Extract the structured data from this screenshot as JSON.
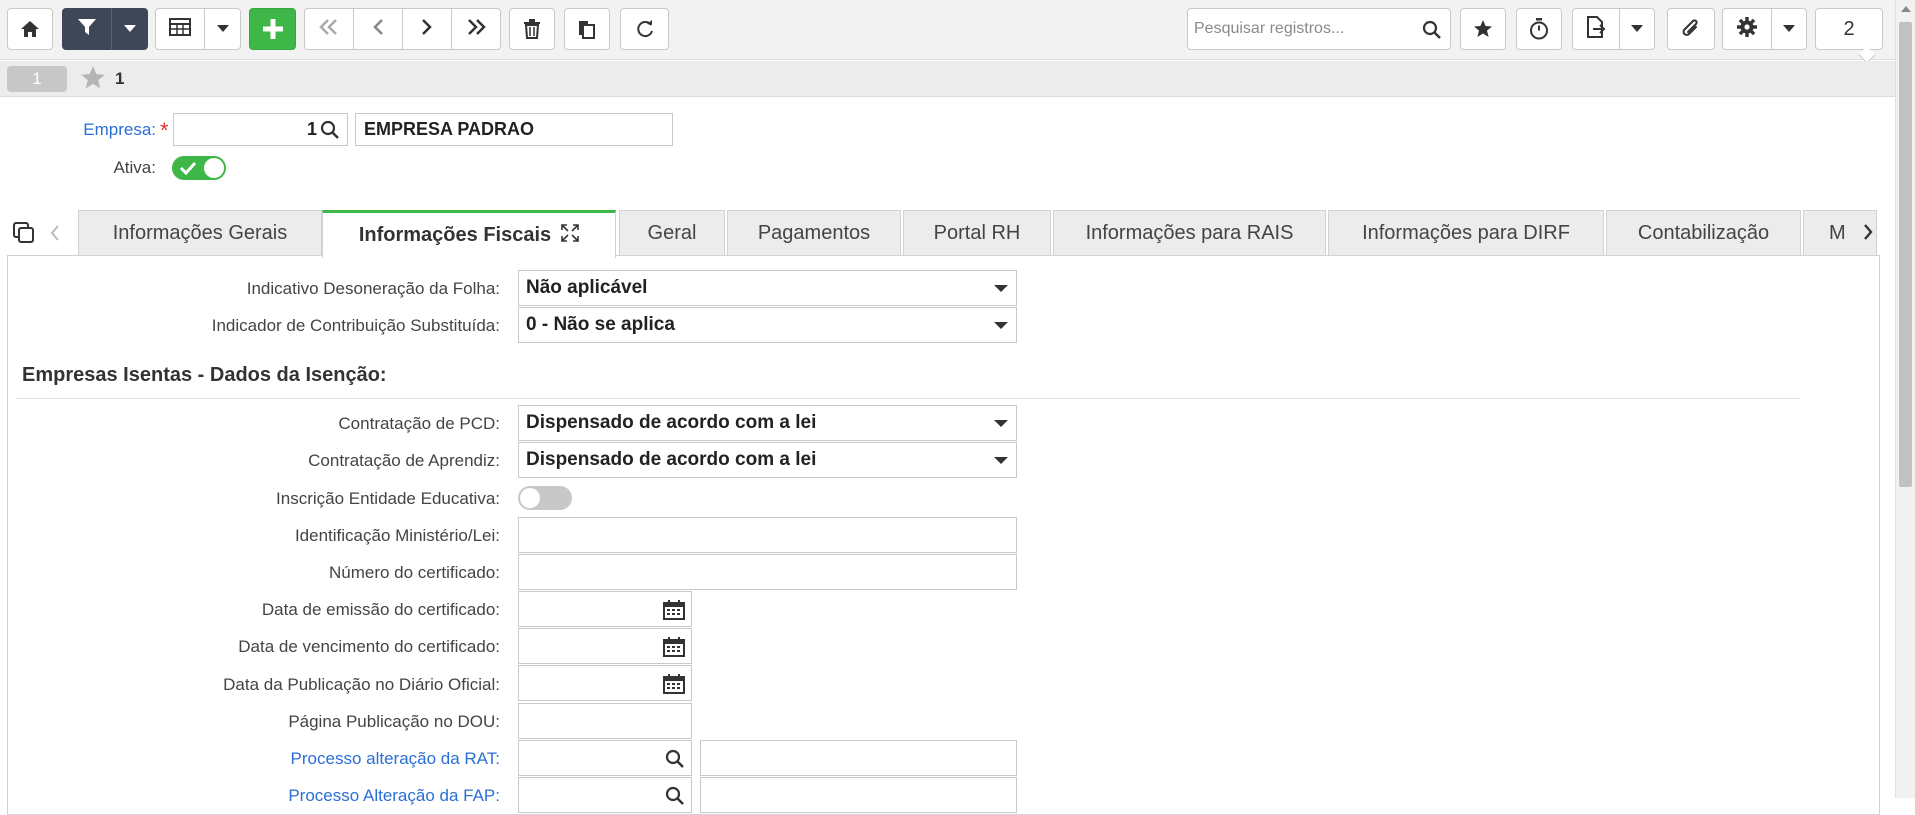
{
  "toolbar": {
    "search_placeholder": "Pesquisar registros...",
    "counter": "2",
    "icons": [
      "home-icon",
      "filter-icon",
      "chevron-down-icon",
      "grid-icon",
      "chevron-down-icon",
      "plus-icon",
      "first-icon",
      "prev-icon",
      "next-icon",
      "last-icon",
      "trash-icon",
      "copy-icon",
      "refresh-icon",
      "search-icon",
      "star-icon",
      "timer-icon",
      "export-icon",
      "chevron-down-icon",
      "attach-icon",
      "gear-icon",
      "chevron-down-icon"
    ]
  },
  "record_bar": {
    "record_pill": "1",
    "favorite_count": "1"
  },
  "header": {
    "empresa_label": "Empresa:",
    "empresa_required_mark": "*",
    "empresa_code": "1",
    "empresa_name": "EMPRESA PADRAO",
    "ativa_label": "Ativa:",
    "ativa_on": true
  },
  "tabs": [
    {
      "label": "Informações Gerais",
      "active": false
    },
    {
      "label": "Informações Fiscais",
      "active": true
    },
    {
      "label": "Geral",
      "active": false
    },
    {
      "label": "Pagamentos",
      "active": false
    },
    {
      "label": "Portal RH",
      "active": false
    },
    {
      "label": "Informações para RAIS",
      "active": false
    },
    {
      "label": "Informações para DIRF",
      "active": false
    },
    {
      "label": "Contabilização",
      "active": false
    },
    {
      "label": "M",
      "active": false
    }
  ],
  "form": {
    "desoneracao": {
      "label": "Indicativo Desoneração da Folha:",
      "value": "Não aplicável"
    },
    "contribuicao": {
      "label": "Indicador de Contribuição Substituída:",
      "value": "0 - Não se aplica"
    },
    "section_title": "Empresas Isentas - Dados da Isenção:",
    "pcd": {
      "label": "Contratação de PCD:",
      "value": "Dispensado de acordo com a lei"
    },
    "aprendiz": {
      "label": "Contratação de Aprendiz:",
      "value": "Dispensado de acordo com a lei"
    },
    "inscricao": {
      "label": "Inscrição Entidade Educativa:",
      "on": false
    },
    "identificacao": {
      "label": "Identificação Ministério/Lei:",
      "value": ""
    },
    "numero_cert": {
      "label": "Número do certificado:",
      "value": ""
    },
    "data_emissao": {
      "label": "Data de emissão do certificado:",
      "value": ""
    },
    "data_venc": {
      "label": "Data de vencimento do certificado:",
      "value": ""
    },
    "data_pub": {
      "label": "Data da Publicação no Diário Oficial:",
      "value": ""
    },
    "pagina_dou": {
      "label": "Página Publicação no DOU:",
      "value": ""
    },
    "proc_rat": {
      "label": "Processo alteração da RAT:",
      "value": "",
      "desc": ""
    },
    "proc_fap": {
      "label": "Processo Alteração da FAP:",
      "value": "",
      "desc": ""
    }
  },
  "colors": {
    "accent_green": "#3fb648",
    "dark_button": "#3d4757",
    "link_blue": "#2a6fd6",
    "required_red": "#e0342d"
  }
}
